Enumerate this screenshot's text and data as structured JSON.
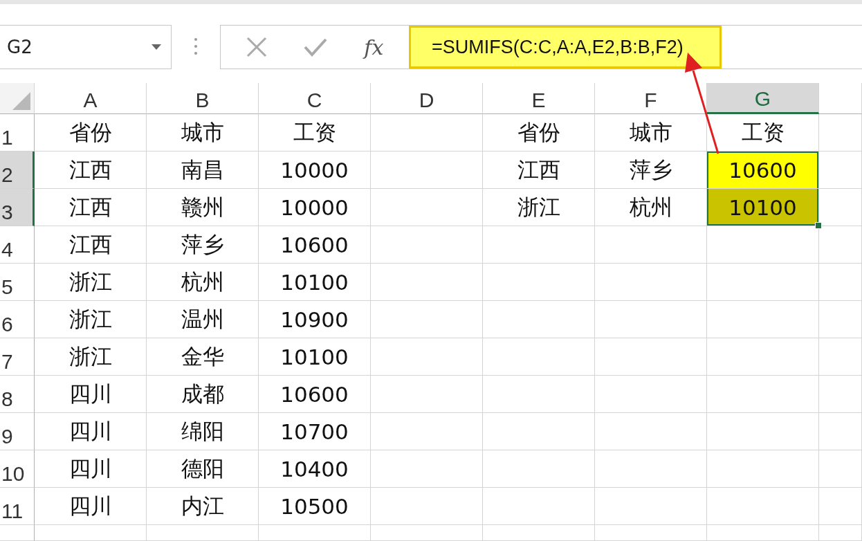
{
  "name_box": {
    "value": "G2"
  },
  "formula_bar": {
    "function_label": "fx",
    "formula": "=SUMIFS(C:C,A:A,E2,B:B,F2)",
    "highlighted": true
  },
  "columns": [
    {
      "label": "A",
      "selected": false
    },
    {
      "label": "B",
      "selected": false
    },
    {
      "label": "C",
      "selected": false
    },
    {
      "label": "D",
      "selected": false
    },
    {
      "label": "E",
      "selected": false
    },
    {
      "label": "F",
      "selected": false
    },
    {
      "label": "G",
      "selected": true
    }
  ],
  "rows": [
    {
      "label": "1",
      "selected": false,
      "cells": {
        "A": {
          "text": "省份",
          "selected": false
        },
        "B": {
          "text": "城市",
          "selected": false
        },
        "C": {
          "text": "工资",
          "selected": false
        },
        "E": {
          "text": "省份",
          "selected": false
        },
        "F": {
          "text": "城市",
          "selected": false
        },
        "G": {
          "text": "工资",
          "selected": false
        }
      }
    },
    {
      "label": "2",
      "selected": true,
      "cells": {
        "A": {
          "text": "江西",
          "selected": false
        },
        "B": {
          "text": "南昌",
          "selected": false
        },
        "C": {
          "text": "10000",
          "selected": false
        },
        "E": {
          "text": "江西",
          "selected": false
        },
        "F": {
          "text": "萍乡",
          "selected": false
        },
        "G": {
          "text": "10600",
          "selected": true,
          "color": "#ffff00"
        }
      }
    },
    {
      "label": "3",
      "selected": true,
      "cells": {
        "A": {
          "text": "江西",
          "selected": false
        },
        "B": {
          "text": "赣州",
          "selected": false
        },
        "C": {
          "text": "10000",
          "selected": false
        },
        "E": {
          "text": "浙江",
          "selected": false
        },
        "F": {
          "text": "杭州",
          "selected": false
        },
        "G": {
          "text": "10100",
          "selected": true,
          "color": "#c9c300"
        }
      }
    },
    {
      "label": "4",
      "selected": false,
      "cells": {
        "A": {
          "text": "江西",
          "selected": false
        },
        "B": {
          "text": "萍乡",
          "selected": false
        },
        "C": {
          "text": "10600",
          "selected": false
        }
      }
    },
    {
      "label": "5",
      "selected": false,
      "cells": {
        "A": {
          "text": "浙江",
          "selected": false
        },
        "B": {
          "text": "杭州",
          "selected": false
        },
        "C": {
          "text": "10100",
          "selected": false
        }
      }
    },
    {
      "label": "6",
      "selected": false,
      "cells": {
        "A": {
          "text": "浙江",
          "selected": false
        },
        "B": {
          "text": "温州",
          "selected": false
        },
        "C": {
          "text": "10900",
          "selected": false
        }
      }
    },
    {
      "label": "7",
      "selected": false,
      "cells": {
        "A": {
          "text": "浙江",
          "selected": false
        },
        "B": {
          "text": "金华",
          "selected": false
        },
        "C": {
          "text": "10100",
          "selected": false
        }
      }
    },
    {
      "label": "8",
      "selected": false,
      "cells": {
        "A": {
          "text": "四川",
          "selected": false
        },
        "B": {
          "text": "成都",
          "selected": false
        },
        "C": {
          "text": "10600",
          "selected": false
        }
      }
    },
    {
      "label": "9",
      "selected": false,
      "cells": {
        "A": {
          "text": "四川",
          "selected": false
        },
        "B": {
          "text": "绵阳",
          "selected": false
        },
        "C": {
          "text": "10700",
          "selected": false
        }
      }
    },
    {
      "label": "10",
      "selected": false,
      "cells": {
        "A": {
          "text": "四川",
          "selected": false
        },
        "B": {
          "text": "德阳",
          "selected": false
        },
        "C": {
          "text": "10400",
          "selected": false
        }
      }
    },
    {
      "label": "11",
      "selected": false,
      "cells": {
        "A": {
          "text": "四川",
          "selected": false
        },
        "B": {
          "text": "内江",
          "selected": false
        },
        "C": {
          "text": "10500",
          "selected": false
        }
      }
    }
  ]
}
